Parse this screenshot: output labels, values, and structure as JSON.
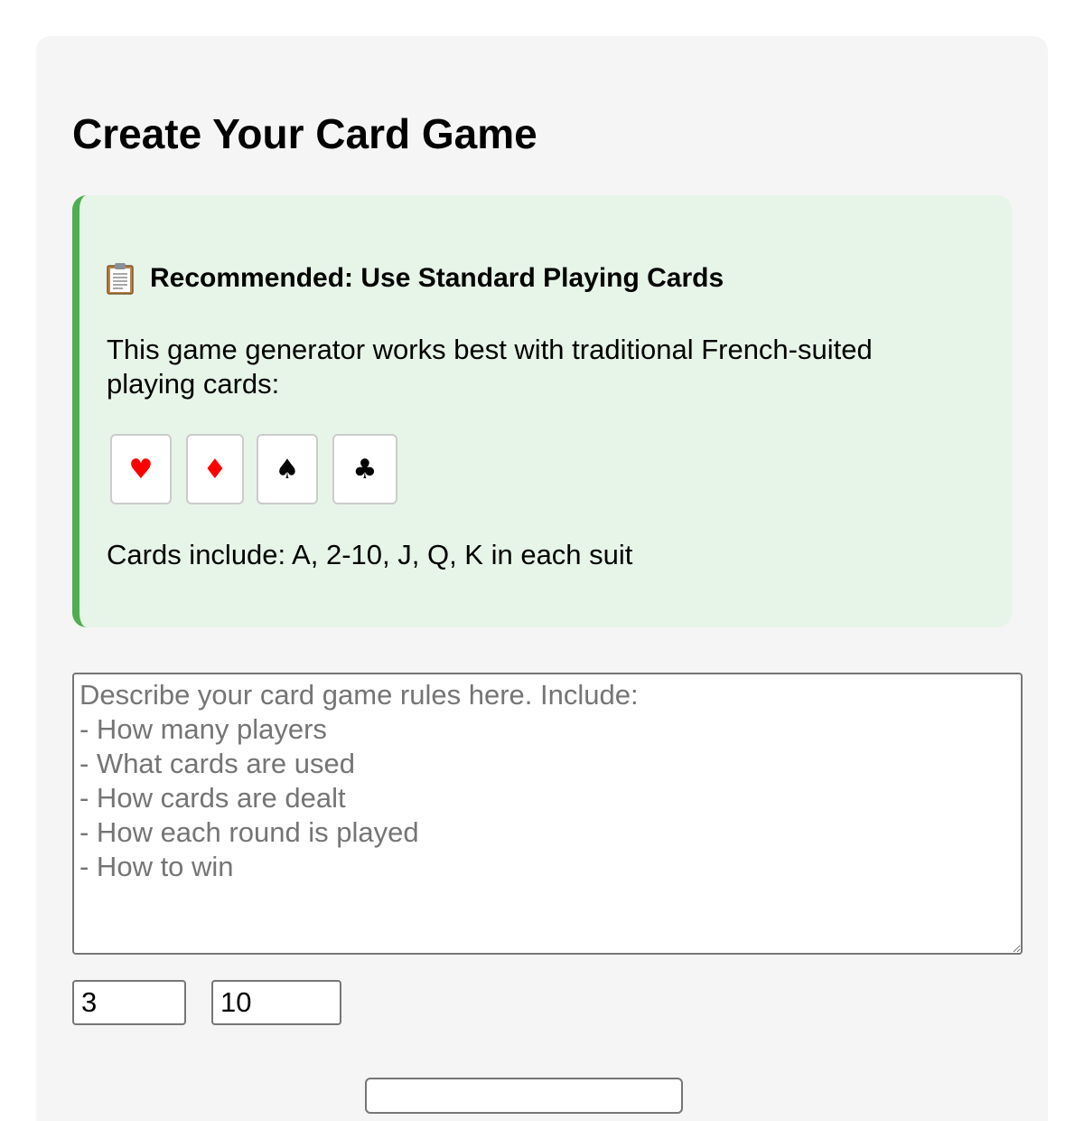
{
  "page": {
    "title": "Create Your Card Game"
  },
  "notice": {
    "heading": "Recommended: Use Standard Playing Cards",
    "body": "This game generator works best with traditional French-suited playing cards:",
    "suits": [
      {
        "name": "hearts",
        "symbol": "♥",
        "color": "#ff0000"
      },
      {
        "name": "diamonds",
        "symbol": "♦",
        "color": "#ff0000"
      },
      {
        "name": "spades",
        "symbol": "♠",
        "color": "#000000"
      },
      {
        "name": "clubs",
        "symbol": "♣",
        "color": "#000000"
      }
    ],
    "footer": "Cards include: A, 2-10, J, Q, K in each suit"
  },
  "form": {
    "rules_placeholder": "Describe your card game rules here. Include:\n- How many players\n- What cards are used\n- How cards are dealt\n- How each round is played\n- How to win",
    "rules_value": "",
    "players_value": "3",
    "rounds_value": "10",
    "submit_label": ""
  },
  "colors": {
    "panel_bg": "#f5f5f5",
    "notice_bg": "#e7f4e8",
    "notice_accent": "#4caf50",
    "red_suit": "#ff0000",
    "black_suit": "#000000"
  }
}
